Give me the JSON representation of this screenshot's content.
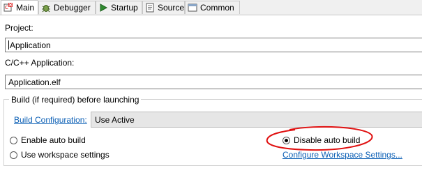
{
  "tabs": [
    {
      "label": "Main",
      "icon": "main-tab-icon",
      "active": true
    },
    {
      "label": "Debugger",
      "icon": "debugger-bug-icon"
    },
    {
      "label": "Startup",
      "icon": "startup-play-icon"
    },
    {
      "label": "Source",
      "icon": "source-icon"
    },
    {
      "label": "Common",
      "icon": "common-icon"
    }
  ],
  "project": {
    "label": "Project:",
    "value": "Application"
  },
  "application": {
    "label": "C/C++ Application:",
    "value": "Application.elf"
  },
  "build": {
    "group_title": "Build (if required) before launching",
    "config_link": "Build Configuration:",
    "config_value": "Use Active",
    "enable_auto": "Enable auto build",
    "workspace_settings": "Use workspace settings",
    "disable_auto": "Disable auto build",
    "configure_link": "Configure Workspace Settings..."
  },
  "colors": {
    "link": "#0b5fb5",
    "annotation": "#e01010"
  }
}
